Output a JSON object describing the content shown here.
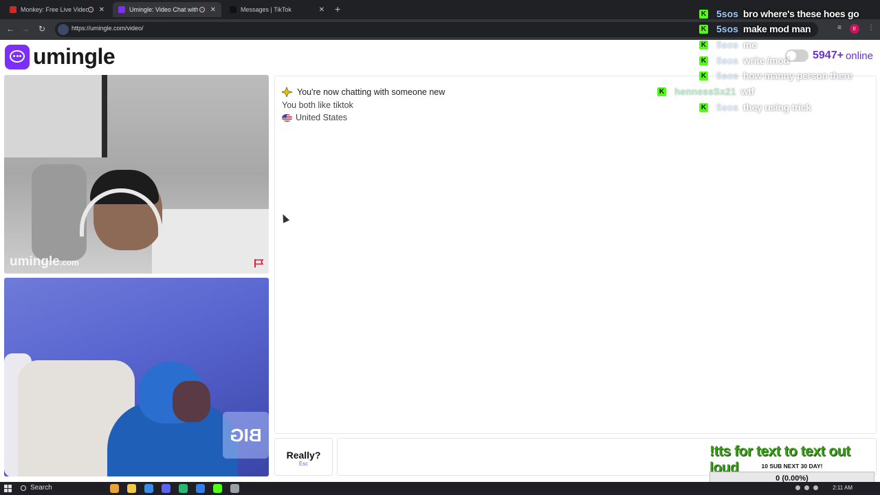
{
  "browser": {
    "tabs": [
      {
        "title": "Monkey: Free Live Video Ch",
        "active": false,
        "favicon_color": "#cc2a2a"
      },
      {
        "title": "Umingle: Video Chat with S",
        "active": true,
        "favicon_color": "#7b2ff7"
      },
      {
        "title": "Messages | TikTok",
        "active": false,
        "favicon_color": "#111111"
      }
    ],
    "url": "https://umingle.com/video/",
    "profile_initial": "E"
  },
  "site": {
    "logo_text": "umingle",
    "online_count": "5947+",
    "online_label": "online",
    "watermark_main": "umingle",
    "watermark_tld": ".com"
  },
  "stranger_video": {
    "neon_text": "BIG"
  },
  "chat": {
    "system_line": "You're now chatting with someone new",
    "shared_interest": "You both like tiktok",
    "country": "United States"
  },
  "controls": {
    "skip_label": "Really?",
    "skip_hint": "Esc"
  },
  "overlay_chat": [
    {
      "user": "5sos",
      "message": "bro where's these hoes go",
      "faded": false
    },
    {
      "user": "5sos",
      "message": "make mod man",
      "faded": false
    },
    {
      "user": "5sos",
      "message": "me",
      "faded": true
    },
    {
      "user": "5sos",
      "message": "write /mod",
      "faded": true
    },
    {
      "user": "5sos",
      "message": "how manny person there",
      "faded": true
    },
    {
      "user": "hennessSx21",
      "message": "wtf",
      "faded": true
    },
    {
      "user": "5sos",
      "message": "they using trick",
      "faded": true
    }
  ],
  "stream_overlay": {
    "tts_banner": "!tts for text to text out loud",
    "sub_goal_title": "10 SUB NEXT 30 DAY!",
    "sub_goal_value": "0 (0.00%)",
    "sub_goal_progress": 0
  },
  "taskbar": {
    "search_label": "Search",
    "clock": "2:11 AM"
  },
  "colors": {
    "accent": "#7b2ff7",
    "online": "#6a2fd8",
    "kick_green": "#53fc18",
    "tts_green": "#3a9d1a"
  }
}
